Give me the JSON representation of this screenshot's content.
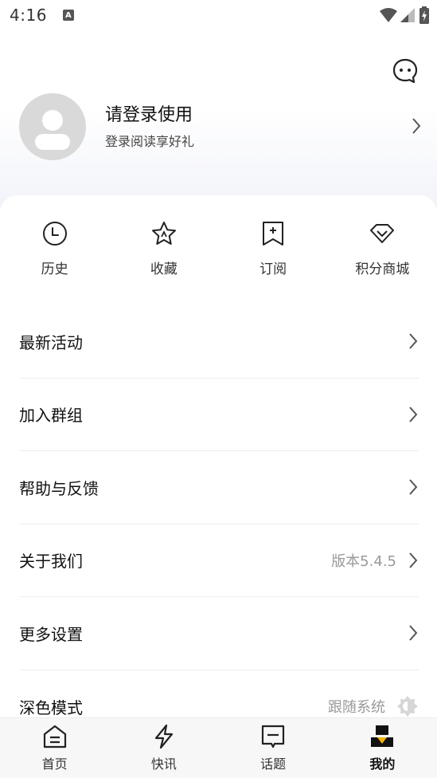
{
  "status_bar": {
    "time": "4:16",
    "notification_letter": "A"
  },
  "profile": {
    "title": "请登录使用",
    "subtitle": "登录阅读享好礼"
  },
  "shortcuts": [
    {
      "label": "历史",
      "icon": "clock-icon"
    },
    {
      "label": "收藏",
      "icon": "star-icon"
    },
    {
      "label": "订阅",
      "icon": "bookmark-add-icon"
    },
    {
      "label": "积分商城",
      "icon": "diamond-icon"
    }
  ],
  "menu": [
    {
      "label": "最新活动",
      "value": ""
    },
    {
      "label": "加入群组",
      "value": ""
    },
    {
      "label": "帮助与反馈",
      "value": ""
    },
    {
      "label": "关于我们",
      "value": "版本5.4.5"
    },
    {
      "label": "更多设置",
      "value": ""
    },
    {
      "label": "深色模式",
      "value": "跟随系统"
    }
  ],
  "tabs": [
    {
      "label": "首页",
      "icon": "home-icon"
    },
    {
      "label": "快讯",
      "icon": "lightning-icon"
    },
    {
      "label": "话题",
      "icon": "topic-icon"
    },
    {
      "label": "我的",
      "icon": "profile-icon"
    }
  ],
  "colors": {
    "accent": "#f5b400",
    "text": "#111111",
    "muted": "#9a9a9a"
  }
}
